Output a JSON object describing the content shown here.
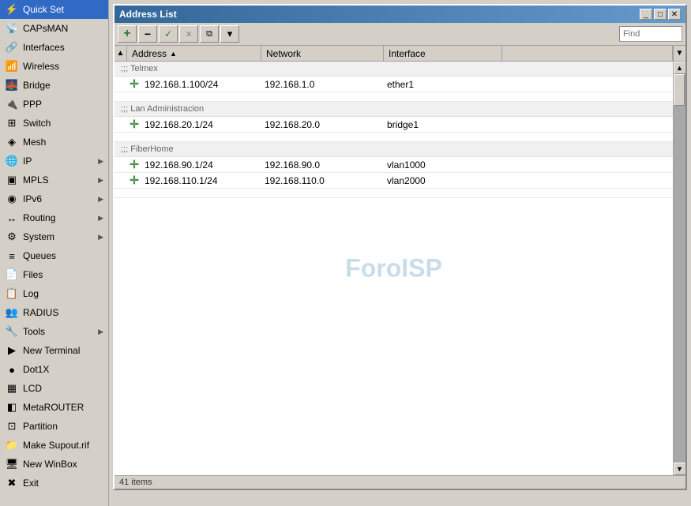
{
  "sidebar": {
    "items": [
      {
        "id": "quick-set",
        "label": "Quick Set",
        "icon": "⚡",
        "hasArrow": false
      },
      {
        "id": "capsman",
        "label": "CAPsMAN",
        "icon": "📡",
        "hasArrow": false
      },
      {
        "id": "interfaces",
        "label": "Interfaces",
        "icon": "🔗",
        "hasArrow": false
      },
      {
        "id": "wireless",
        "label": "Wireless",
        "icon": "📶",
        "hasArrow": false
      },
      {
        "id": "bridge",
        "label": "Bridge",
        "icon": "🌉",
        "hasArrow": false
      },
      {
        "id": "ppp",
        "label": "PPP",
        "icon": "🔌",
        "hasArrow": false
      },
      {
        "id": "switch",
        "label": "Switch",
        "icon": "⊞",
        "hasArrow": false
      },
      {
        "id": "mesh",
        "label": "Mesh",
        "icon": "◈",
        "hasArrow": false
      },
      {
        "id": "ip",
        "label": "IP",
        "icon": "🌐",
        "hasArrow": true
      },
      {
        "id": "mpls",
        "label": "MPLS",
        "icon": "▣",
        "hasArrow": true
      },
      {
        "id": "ipv6",
        "label": "IPv6",
        "icon": "◉",
        "hasArrow": true
      },
      {
        "id": "routing",
        "label": "Routing",
        "icon": "↔",
        "hasArrow": true
      },
      {
        "id": "system",
        "label": "System",
        "icon": "⚙",
        "hasArrow": true
      },
      {
        "id": "queues",
        "label": "Queues",
        "icon": "≡",
        "hasArrow": false
      },
      {
        "id": "files",
        "label": "Files",
        "icon": "📄",
        "hasArrow": false
      },
      {
        "id": "log",
        "label": "Log",
        "icon": "📋",
        "hasArrow": false
      },
      {
        "id": "radius",
        "label": "RADIUS",
        "icon": "👥",
        "hasArrow": false
      },
      {
        "id": "tools",
        "label": "Tools",
        "icon": "🔧",
        "hasArrow": true
      },
      {
        "id": "new-terminal",
        "label": "New Terminal",
        "icon": "▶",
        "hasArrow": false
      },
      {
        "id": "dot1x",
        "label": "Dot1X",
        "icon": "●",
        "hasArrow": false
      },
      {
        "id": "lcd",
        "label": "LCD",
        "icon": "▦",
        "hasArrow": false
      },
      {
        "id": "metarouter",
        "label": "MetaROUTER",
        "icon": "◧",
        "hasArrow": false
      },
      {
        "id": "partition",
        "label": "Partition",
        "icon": "⊡",
        "hasArrow": false
      },
      {
        "id": "make-supout",
        "label": "Make Supout.rif",
        "icon": "📁",
        "hasArrow": false
      },
      {
        "id": "new-winbox",
        "label": "New WinBox",
        "icon": "🖥",
        "hasArrow": false
      },
      {
        "id": "exit",
        "label": "Exit",
        "icon": "✖",
        "hasArrow": false
      }
    ]
  },
  "window": {
    "title": "Address List",
    "controls": {
      "minimize": "_",
      "maximize": "□",
      "close": "✕"
    }
  },
  "toolbar": {
    "add_label": "+",
    "remove_label": "−",
    "enable_label": "✓",
    "disable_label": "✕",
    "copy_label": "⧉",
    "filter_label": "▾",
    "find_placeholder": "Find"
  },
  "table": {
    "columns": [
      {
        "id": "address",
        "label": "Address",
        "sortable": true
      },
      {
        "id": "network",
        "label": "Network",
        "sortable": false
      },
      {
        "id": "interface",
        "label": "Interface",
        "sortable": false
      },
      {
        "id": "extra",
        "label": "",
        "sortable": false
      }
    ],
    "sections": [
      {
        "id": "telmex",
        "header": ";;; Telmex",
        "rows": [
          {
            "address": "192.168.1.100/24",
            "network": "192.168.1.0",
            "interface": "ether1"
          }
        ]
      },
      {
        "id": "lan-admin",
        "header": ";;; Lan Administracion",
        "rows": [
          {
            "address": "192.168.20.1/24",
            "network": "192.168.20.0",
            "interface": "bridge1"
          }
        ]
      },
      {
        "id": "fiberhome",
        "header": ";;; FiberHome",
        "rows": [
          {
            "address": "192.168.90.1/24",
            "network": "192.168.90.0",
            "interface": "vlan1000"
          },
          {
            "address": "192.168.110.1/24",
            "network": "192.168.110.0",
            "interface": "vlan2000"
          }
        ]
      }
    ],
    "watermark": "ForoISP",
    "status": "41 items"
  }
}
